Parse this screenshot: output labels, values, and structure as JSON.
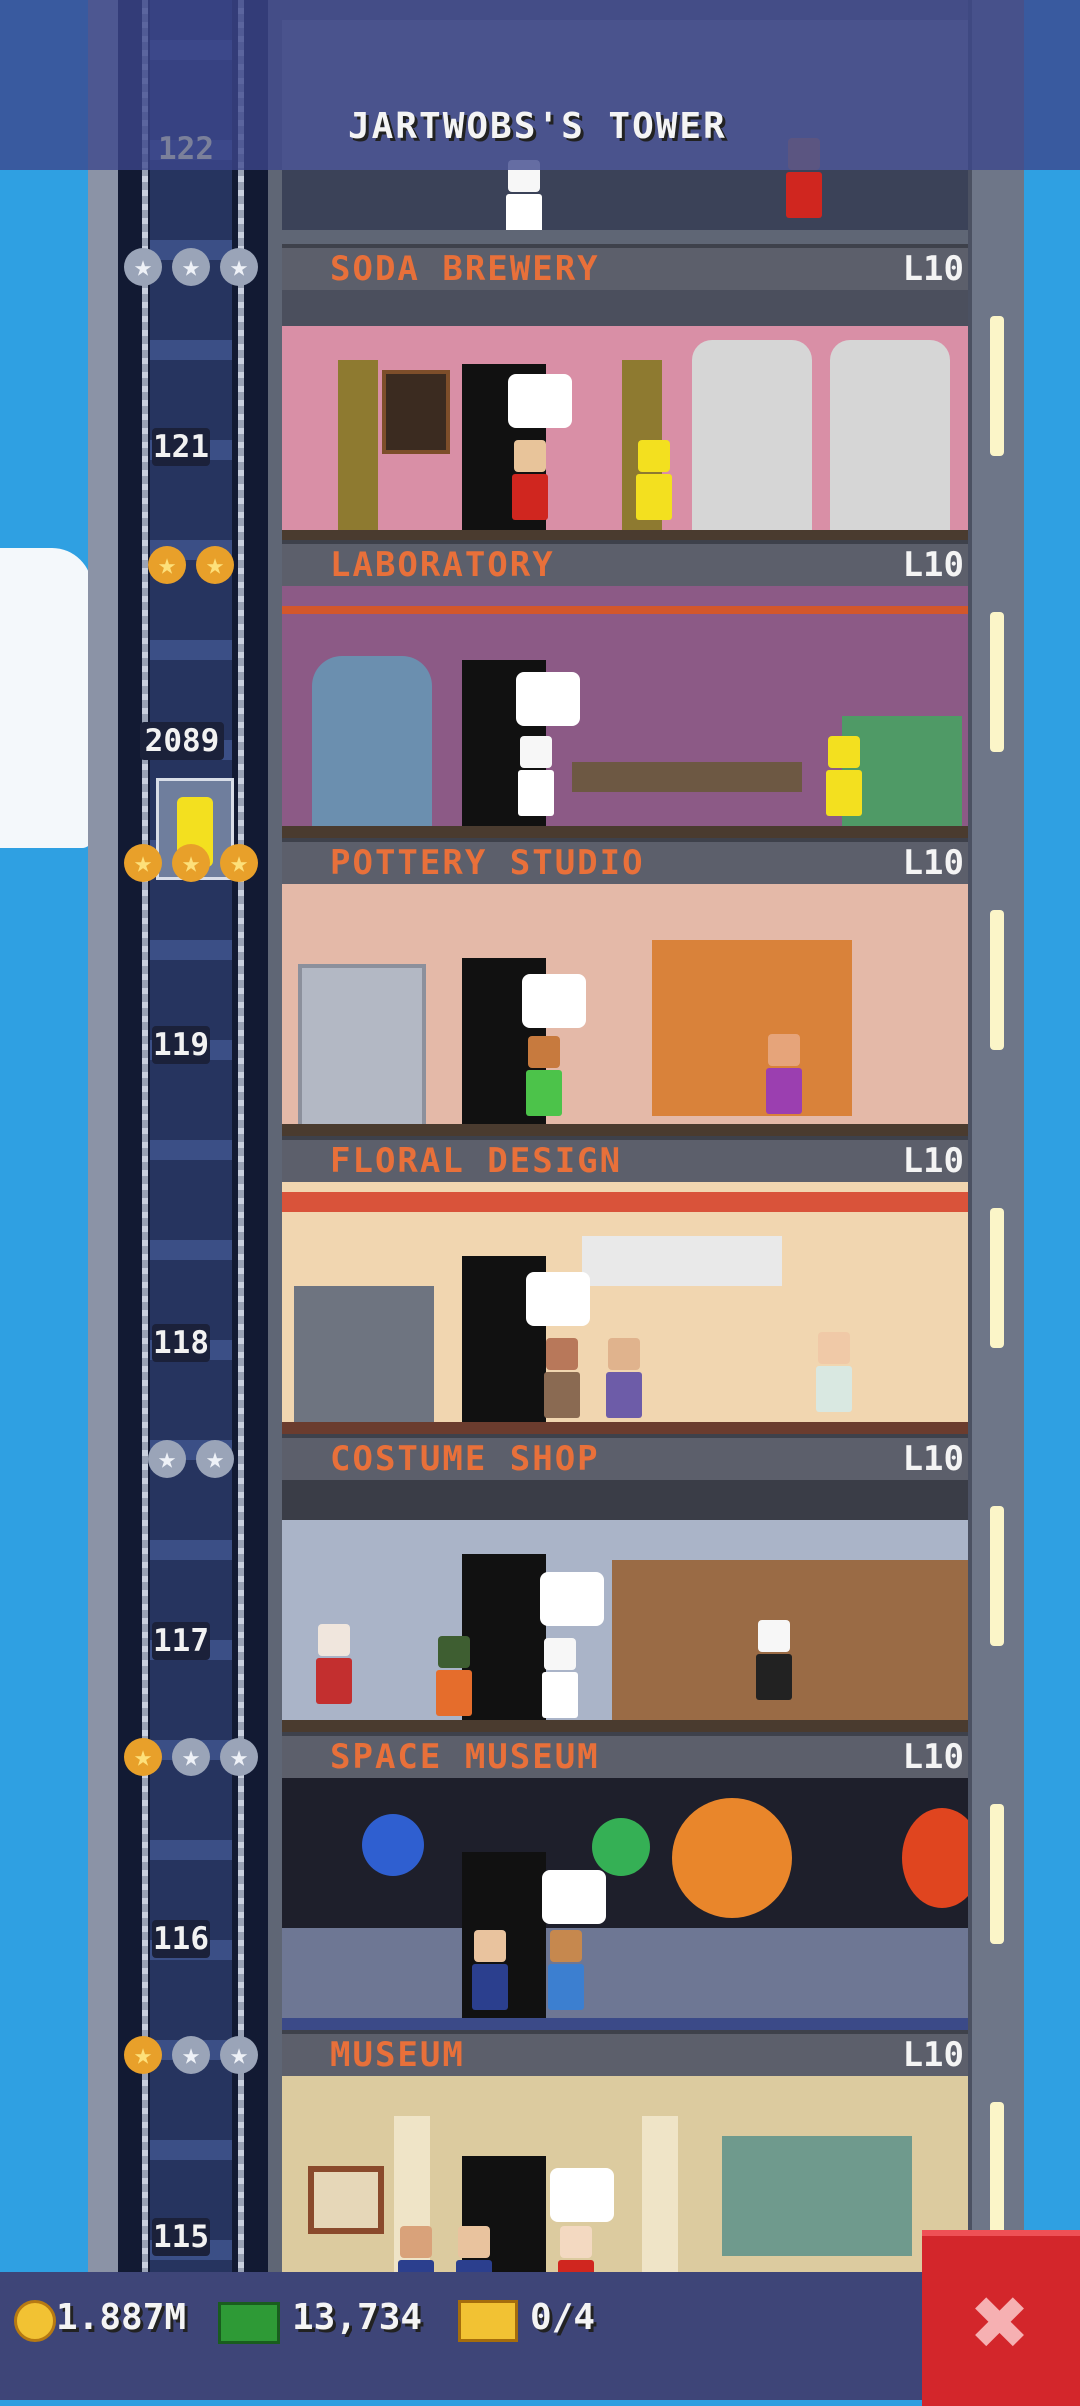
{
  "tower": {
    "title": "JARTWOBS'S TOWER"
  },
  "floors": [
    {
      "name": "SODA BREWERY",
      "level": "L10",
      "number": "121"
    },
    {
      "name": "LABORATORY",
      "level": "L10",
      "number": "2089"
    },
    {
      "name": "POTTERY STUDIO",
      "level": "L10",
      "number": "119"
    },
    {
      "name": "FLORAL DESIGN",
      "level": "L10",
      "number": "118"
    },
    {
      "name": "COSTUME SHOP",
      "level": "L10",
      "number": "117"
    },
    {
      "name": "SPACE MUSEUM",
      "level": "L10",
      "number": "116"
    },
    {
      "name": "MUSEUM",
      "level": "L10",
      "number": "115"
    }
  ],
  "top_floor_number": "122",
  "stars": [
    {
      "gold": 0,
      "silver": 3
    },
    {
      "gold": 2,
      "silver": 0
    },
    {
      "gold": 3,
      "silver": 0
    },
    {
      "gold": 0,
      "silver": 2
    },
    {
      "gold": 1,
      "silver": 2
    },
    {
      "gold": 1,
      "silver": 2
    }
  ],
  "hud": {
    "coins": "1.887M",
    "bux": "13,734",
    "tickets": "0/4",
    "coin_icon": "coin-icon",
    "bux_icon": "cash-icon",
    "ticket_icon": "ticket-icon"
  },
  "close_button": {
    "label": "✖",
    "icon": "close-icon"
  },
  "colors": {
    "sky": "#2fa0e2",
    "floor_name": "#e8703a",
    "close_button": "#d3262b",
    "hud_bar": "#3e4578"
  }
}
